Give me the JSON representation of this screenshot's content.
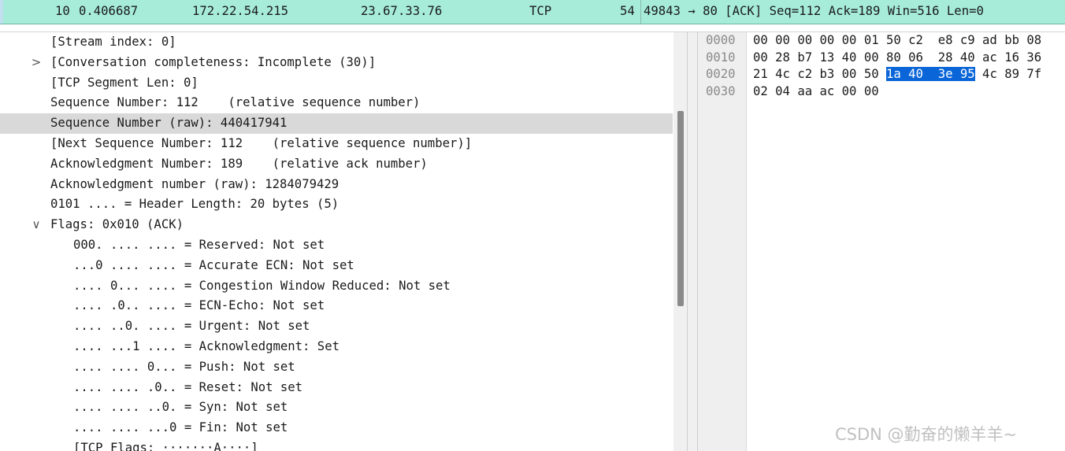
{
  "packet_row": {
    "no": "10",
    "time": "0.406687",
    "source": "172.22.54.215",
    "destination": "23.67.33.76",
    "protocol": "TCP",
    "length": "54",
    "info": "49843 → 80 [ACK] Seq=112 Ack=189 Win=516 Len=0"
  },
  "details": {
    "lines": [
      {
        "text": "[Stream index: 0]",
        "expander": ""
      },
      {
        "text": "[Conversation completeness: Incomplete (30)]",
        "expander": ">"
      },
      {
        "text": "[TCP Segment Len: 0]",
        "expander": ""
      },
      {
        "text": "Sequence Number: 112    (relative sequence number)",
        "expander": ""
      },
      {
        "text": "Sequence Number (raw): 440417941",
        "expander": "",
        "selected": true
      },
      {
        "text": "[Next Sequence Number: 112    (relative sequence number)]",
        "expander": ""
      },
      {
        "text": "Acknowledgment Number: 189    (relative ack number)",
        "expander": ""
      },
      {
        "text": "Acknowledgment number (raw): 1284079429",
        "expander": ""
      },
      {
        "text": "0101 .... = Header Length: 20 bytes (5)",
        "expander": ""
      },
      {
        "text": "Flags: 0x010 (ACK)",
        "expander": "∨"
      },
      {
        "text": "000. .... .... = Reserved: Not set",
        "expander": "",
        "indent": 1
      },
      {
        "text": "...0 .... .... = Accurate ECN: Not set",
        "expander": "",
        "indent": 1
      },
      {
        "text": ".... 0... .... = Congestion Window Reduced: Not set",
        "expander": "",
        "indent": 1
      },
      {
        "text": ".... .0.. .... = ECN-Echo: Not set",
        "expander": "",
        "indent": 1
      },
      {
        "text": ".... ..0. .... = Urgent: Not set",
        "expander": "",
        "indent": 1
      },
      {
        "text": ".... ...1 .... = Acknowledgment: Set",
        "expander": "",
        "indent": 1
      },
      {
        "text": ".... .... 0... = Push: Not set",
        "expander": "",
        "indent": 1
      },
      {
        "text": ".... .... .0.. = Reset: Not set",
        "expander": "",
        "indent": 1
      },
      {
        "text": ".... .... ..0. = Syn: Not set",
        "expander": "",
        "indent": 1
      },
      {
        "text": ".... .... ...0 = Fin: Not set",
        "expander": "",
        "indent": 1
      },
      {
        "text": "[TCP Flags: ·······A····]",
        "expander": "",
        "indent": 1
      }
    ]
  },
  "hex": {
    "offsets": [
      "0000",
      "0010",
      "0020",
      "0030"
    ],
    "rows": [
      {
        "before": "00 00 00 00 00 01 50 c2  e8 c9 ad bb 08",
        "highlight": "",
        "after": ""
      },
      {
        "before": "00 28 b7 13 40 00 80 06  28 40 ac 16 36",
        "highlight": "",
        "after": ""
      },
      {
        "before": "21 4c c2 b3 00 50 ",
        "highlight": "1a 40  3e 95",
        "after": " 4c 89 7f"
      },
      {
        "before": "02 04 aa ac 00 00",
        "highlight": "",
        "after": ""
      }
    ],
    "highlight_color": "#0a66d8"
  },
  "watermark": "CSDN @勤奋的懒羊羊~",
  "colors": {
    "packet_row_bg": "#a6ecd9",
    "selected_line_bg": "#d9d9d9"
  }
}
